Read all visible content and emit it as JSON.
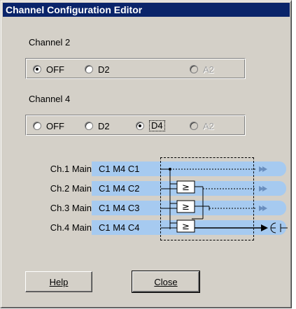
{
  "window": {
    "title": "Channel Configuration Editor"
  },
  "channel2": {
    "label": "Channel 2",
    "options": [
      {
        "label": "OFF",
        "checked": true,
        "disabled": false
      },
      {
        "label": "D2",
        "checked": false,
        "disabled": false
      },
      {
        "label": "A2",
        "checked": false,
        "disabled": true
      }
    ]
  },
  "channel4": {
    "label": "Channel 4",
    "options": [
      {
        "label": "OFF",
        "checked": false,
        "disabled": false
      },
      {
        "label": "D2",
        "checked": false,
        "disabled": false
      },
      {
        "label": "D4",
        "checked": true,
        "disabled": false
      },
      {
        "label": "A2",
        "checked": false,
        "disabled": true
      }
    ]
  },
  "routing": {
    "rows": [
      {
        "label": "Ch.1 Main",
        "value": "C1 M4 C1"
      },
      {
        "label": "Ch.2 Main",
        "value": "C1 M4 C2"
      },
      {
        "label": "Ch.3 Main",
        "value": "C1 M4 C3"
      },
      {
        "label": "Ch.4 Main",
        "value": "C1 M4 C4"
      }
    ],
    "gate_symbol": "≥",
    "bar_color": "#a6caf0"
  },
  "buttons": {
    "help": "Help",
    "close": "Close"
  }
}
